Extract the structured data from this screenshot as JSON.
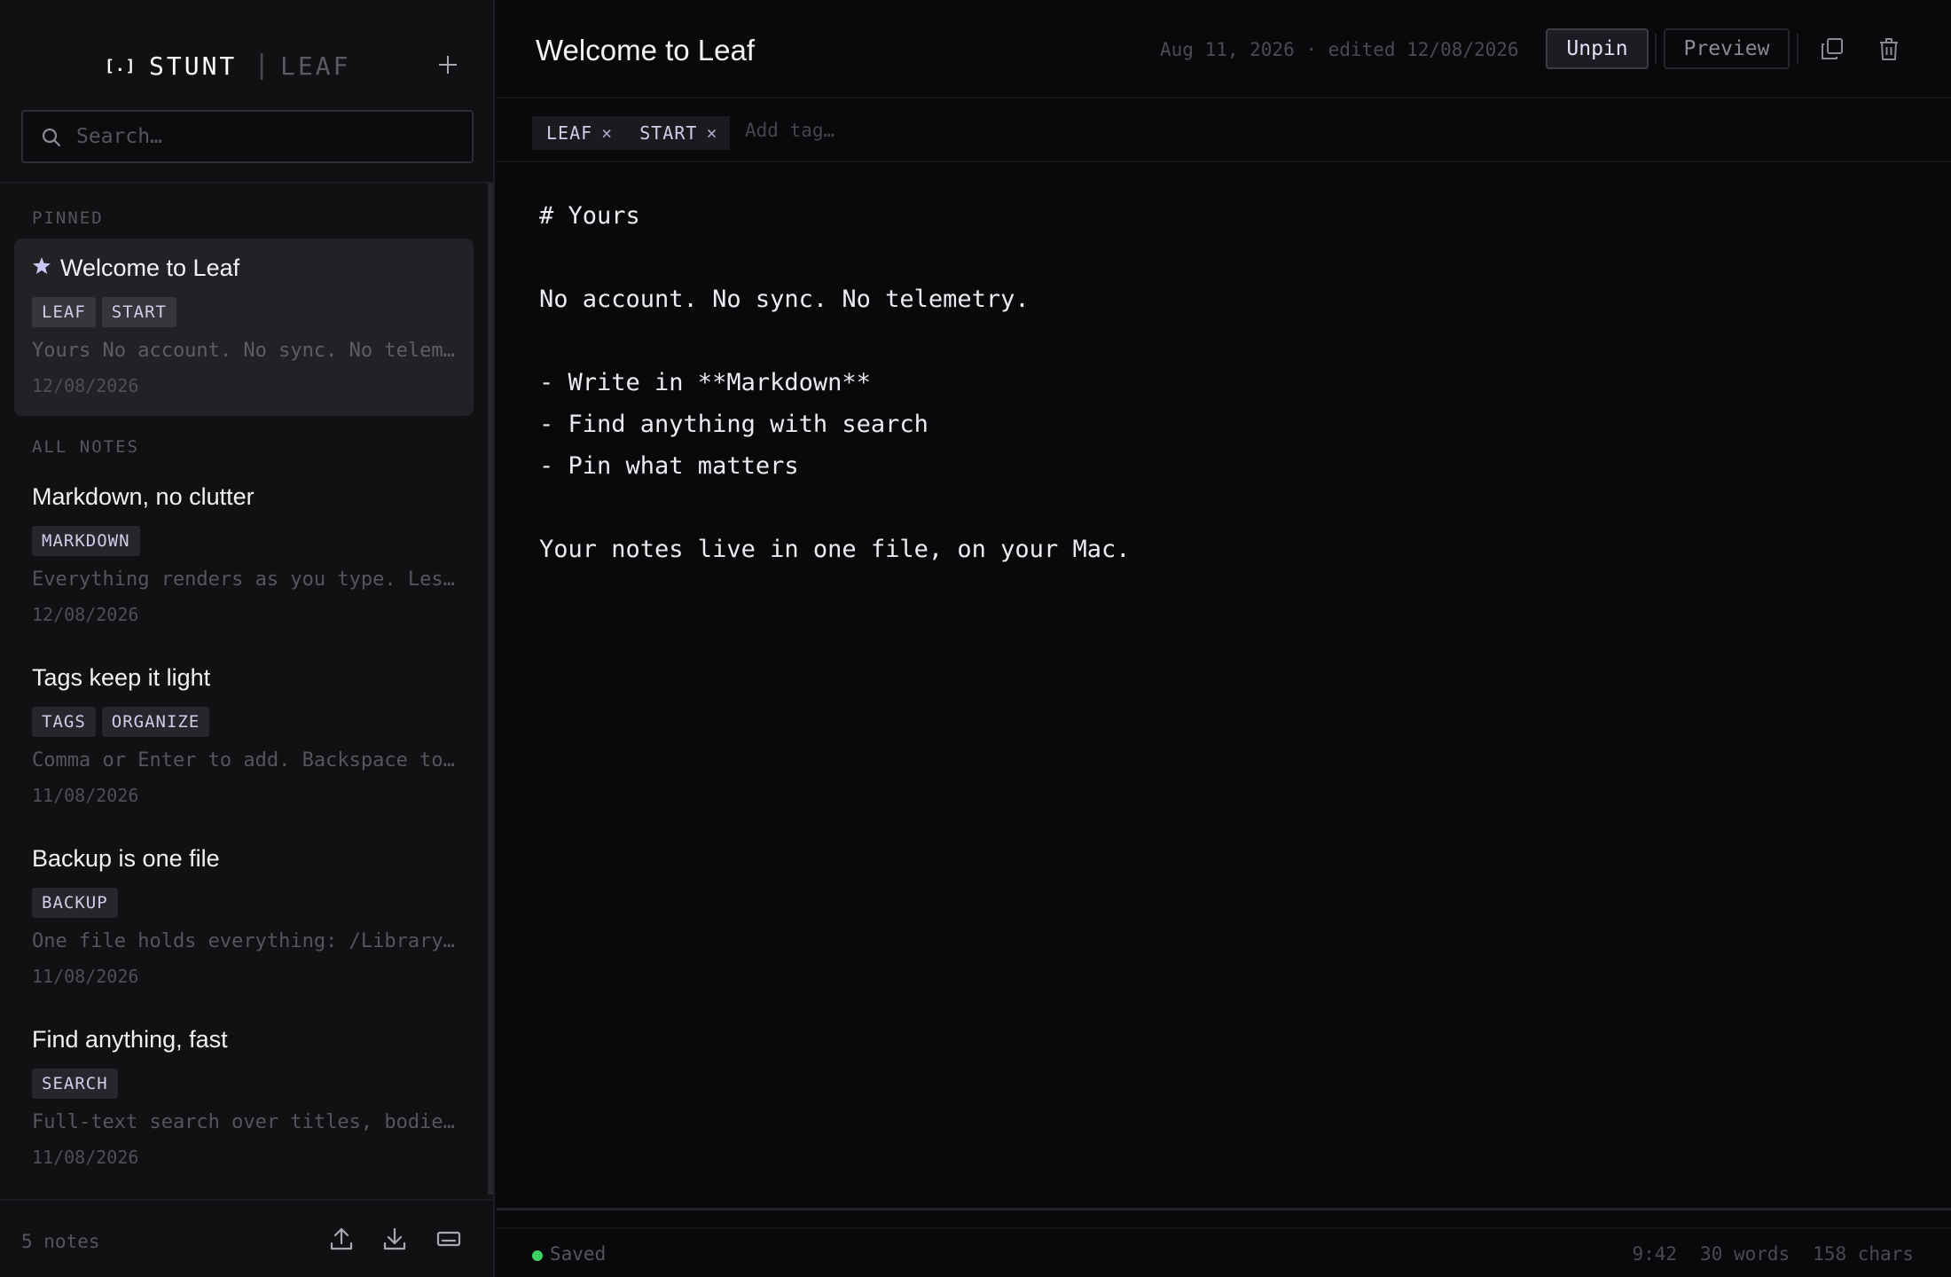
{
  "sidebar": {
    "brand_mark": "[.]",
    "brand_name": "STUNT",
    "brand_sep": "|",
    "brand_sub": "LEAF",
    "new_note_icon": "plus-icon",
    "search_placeholder": "Search…",
    "search_value": "",
    "pinned_label": "PINNED",
    "all_notes_label": "ALL NOTES",
    "pinned_notes": [
      {
        "title": "Welcome to Leaf",
        "tags": [
          "LEAF",
          "START"
        ],
        "preview": "Yours No account. No sync. No telemetry.",
        "date": "12/08/2026"
      }
    ],
    "notes": [
      {
        "title": "Markdown, no clutter",
        "tags": [
          "MARKDOWN"
        ],
        "preview": "Everything renders as you type. Less friction, more writing.",
        "date": "12/08/2026"
      },
      {
        "title": "Tags keep it light",
        "tags": [
          "TAGS",
          "ORGANIZE"
        ],
        "preview": "Comma or Enter to add. Backspace to remove.",
        "date": "11/08/2026"
      },
      {
        "title": "Backup is one file",
        "tags": [
          "BACKUP"
        ],
        "preview": "One file holds everything: /Library/Leaf/notes.json",
        "date": "11/08/2026"
      },
      {
        "title": "Find anything, fast",
        "tags": [
          "SEARCH"
        ],
        "preview": "Full-text search over titles, bodies and tags.",
        "date": "11/08/2026"
      }
    ],
    "footer": {
      "count": "5 notes",
      "icons": [
        "upload-icon",
        "download-icon",
        "keyboard-icon"
      ]
    }
  },
  "editor": {
    "title": "Welcome to Leaf",
    "meta": "Aug 11, 2026 · edited 12/08/2026",
    "unpin_label": "Unpin",
    "preview_label": "Preview",
    "icons": [
      "copy-icon",
      "trash-icon"
    ],
    "tags": [
      "LEAF",
      "START"
    ],
    "tag_remove": "×",
    "add_tag_placeholder": "Add tag…",
    "lines": [
      "# Yours",
      "",
      "No account. No sync. No telemetry.",
      "",
      "- Write in **Markdown**",
      "- Find anything with search",
      "- Pin what matters",
      "",
      "Your notes live in one file, on your Mac."
    ]
  },
  "status": {
    "saved": "Saved",
    "time": "9:42",
    "words": "30 words",
    "chars": "158 chars"
  },
  "colors": {
    "accent": "#c8c6f2",
    "saved": "#3fcf68",
    "background": "#09090b",
    "sidebar": "#111113"
  }
}
